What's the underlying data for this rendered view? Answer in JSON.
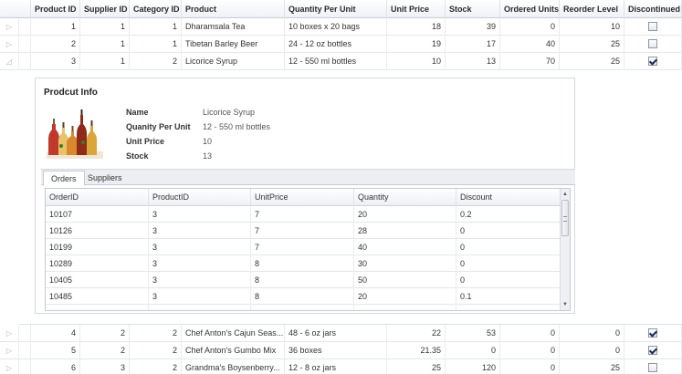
{
  "grid": {
    "columns": [
      "Product ID",
      "Supplier ID",
      "Category ID",
      "Product",
      "Quantity Per Unit",
      "Unit Price",
      "Stock",
      "Ordered Units",
      "Reorder Level",
      "Discontinued"
    ],
    "rows_top": [
      {
        "id": "1",
        "supplier": "1",
        "category": "1",
        "product": "Dharamsala Tea",
        "qty": "10 boxes x 20 bags",
        "price": "18",
        "stock": "39",
        "ordered": "0",
        "reorder": "10",
        "discontinued": false,
        "indicator": "▷"
      },
      {
        "id": "2",
        "supplier": "1",
        "category": "1",
        "product": "Tibetan Barley Beer",
        "qty": "24 - 12 oz bottles",
        "price": "19",
        "stock": "17",
        "ordered": "40",
        "reorder": "25",
        "discontinued": false,
        "indicator": "▷"
      },
      {
        "id": "3",
        "supplier": "1",
        "category": "2",
        "product": "Licorice Syrup",
        "qty": "12 - 550 ml bottles",
        "price": "10",
        "stock": "13",
        "ordered": "70",
        "reorder": "25",
        "discontinued": true,
        "indicator": "◿"
      }
    ],
    "rows_bottom": [
      {
        "id": "4",
        "supplier": "2",
        "category": "2",
        "product": "Chef Anton's Cajun Seas...",
        "qty": "48 - 6 oz jars",
        "price": "22",
        "stock": "53",
        "ordered": "0",
        "reorder": "0",
        "discontinued": true,
        "indicator": "▷"
      },
      {
        "id": "5",
        "supplier": "2",
        "category": "2",
        "product": "Chef Anton's Gumbo Mix",
        "qty": "36 boxes",
        "price": "21.35",
        "stock": "0",
        "ordered": "0",
        "reorder": "0",
        "discontinued": true,
        "indicator": "▷"
      },
      {
        "id": "6",
        "supplier": "3",
        "category": "2",
        "product": "Grandma's Boysenberry...",
        "qty": "12 - 8 oz jars",
        "price": "25",
        "stock": "120",
        "ordered": "0",
        "reorder": "25",
        "discontinued": false,
        "indicator": "▷"
      }
    ]
  },
  "detail": {
    "title": "Prodcut Info",
    "labels": {
      "name": "Name",
      "qpu": "Quanity Per Unit",
      "price": "Unit Price",
      "stock": "Stock"
    },
    "values": {
      "name": "Licorice Syrup",
      "qpu": "12 - 550 ml bottles",
      "price": "10",
      "stock": "13"
    },
    "tabs": [
      "Orders",
      "Suppliers"
    ],
    "orders": {
      "columns": [
        "OrderID",
        "ProductID",
        "UnitPrice",
        "Quantity",
        "Discount"
      ],
      "rows": [
        [
          "10107",
          "3",
          "7",
          "20",
          "0.2"
        ],
        [
          "10126",
          "3",
          "7",
          "28",
          "0"
        ],
        [
          "10199",
          "3",
          "7",
          "40",
          "0"
        ],
        [
          "10289",
          "3",
          "8",
          "30",
          "0"
        ],
        [
          "10405",
          "3",
          "8",
          "50",
          "0"
        ],
        [
          "10485",
          "3",
          "8",
          "20",
          "0.1"
        ],
        [
          "",
          "",
          "",
          "",
          ""
        ]
      ]
    }
  },
  "icons": {
    "collapsed": "expand-arrow-icon",
    "expanded": "collapse-arrow-icon",
    "scroll_up": "▲",
    "scroll_down": "▼"
  }
}
